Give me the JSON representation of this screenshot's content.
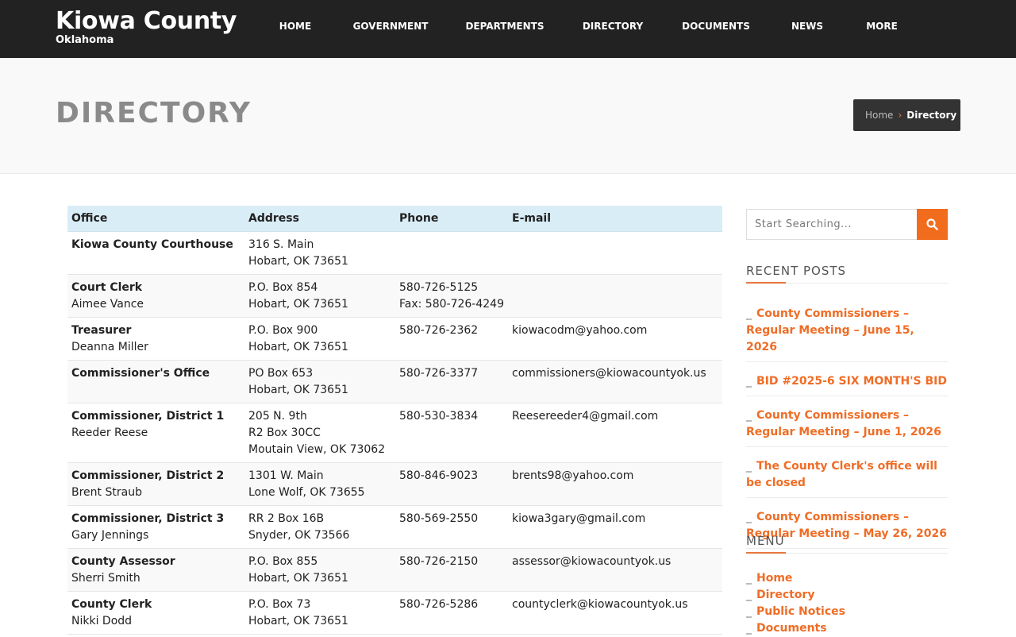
{
  "brand": {
    "title": "Kiowa County",
    "subtitle": "Oklahoma"
  },
  "nav": [
    {
      "label": "HOME"
    },
    {
      "label": "GOVERNMENT"
    },
    {
      "label": "DEPARTMENTS"
    },
    {
      "label": "DIRECTORY",
      "active": true
    },
    {
      "label": "DOCUMENTS"
    },
    {
      "label": "NEWS"
    },
    {
      "label": "MORE"
    }
  ],
  "page": {
    "title": "DIRECTORY"
  },
  "breadcrumb": {
    "home": "Home",
    "separator": "›",
    "current": "Directory"
  },
  "table": {
    "headers": [
      "Office",
      "Address",
      "Phone",
      "E-mail"
    ],
    "rows": [
      {
        "office": "Kiowa County Courthouse",
        "person": "",
        "address1": "316 S. Main",
        "address2": "Hobart, OK 73651",
        "address3": "",
        "phone1": "",
        "phone2": "",
        "email": ""
      },
      {
        "office": "Court Clerk",
        "person": "Aimee Vance",
        "address1": "P.O. Box 854",
        "address2": "Hobart, OK 73651",
        "address3": "",
        "phone1": "580-726-5125",
        "phone2": "Fax: 580-726-4249",
        "email": ""
      },
      {
        "office": "Treasurer",
        "person": "Deanna Miller",
        "address1": "P.O. Box 900",
        "address2": "Hobart, OK 73651",
        "address3": "",
        "phone1": "580-726-2362",
        "phone2": "",
        "email": "kiowacodm@yahoo.com"
      },
      {
        "office": "Commissioner's Office",
        "person": "",
        "address1": "PO Box 653",
        "address2": "Hobart, OK 73651",
        "address3": "",
        "phone1": "580-726-3377",
        "phone2": "",
        "email": "commissioners@kiowacountyok.us"
      },
      {
        "office": "Commissioner, District 1",
        "person": "Reeder Reese",
        "address1": "205 N. 9th",
        "address2": "R2 Box 30CC",
        "address3": "Moutain View, OK 73062",
        "phone1": "580-530-3834",
        "phone2": "",
        "email": "Reesereeder4@gmail.com"
      },
      {
        "office": "Commissioner, District 2",
        "person": "Brent Straub",
        "address1": "1301 W. Main",
        "address2": "Lone Wolf, OK 73655",
        "address3": "",
        "phone1": "580-846-9023",
        "phone2": "",
        "email": "brents98@yahoo.com"
      },
      {
        "office": "Commissioner, District 3",
        "person": "Gary Jennings",
        "address1": "RR 2 Box 16B",
        "address2": "Snyder, OK 73566",
        "address3": "",
        "phone1": "580-569-2550",
        "phone2": "",
        "email": "kiowa3gary@gmail.com"
      },
      {
        "office": "County Assessor",
        "person": "Sherri Smith",
        "address1": "P.O. Box 855",
        "address2": "Hobart, OK 73651",
        "address3": "",
        "phone1": "580-726-2150",
        "phone2": "",
        "email": "assessor@kiowacountyok.us"
      },
      {
        "office": "County Clerk",
        "person": "Nikki Dodd",
        "address1": "P.O. Box 73",
        "address2": "Hobart, OK 73651",
        "address3": "",
        "phone1": "580-726-5286",
        "phone2": "",
        "email": "countyclerk@kiowacountyok.us"
      }
    ]
  },
  "sidebar": {
    "search_placeholder": "Start Searching...",
    "recent_title": "RECENT POSTS",
    "posts": [
      "County Commissioners – Regular Meeting – June 15, 2026",
      "BID #2025-6 SIX MONTH'S BID",
      "County Commissioners – Regular Meeting – June 1, 2026",
      "The County Clerk's office will be closed",
      "County Commissioners – Regular Meeting – May 26, 2026"
    ],
    "menu_title": "MENU",
    "menu": [
      "Home",
      "Directory",
      "Public Notices",
      "Documents"
    ],
    "dash": "_"
  },
  "colors": {
    "accent": "#ef6d26",
    "header_bg": "#222222",
    "table_head": "#d9edf7"
  },
  "icons": {
    "search": "search-icon"
  }
}
